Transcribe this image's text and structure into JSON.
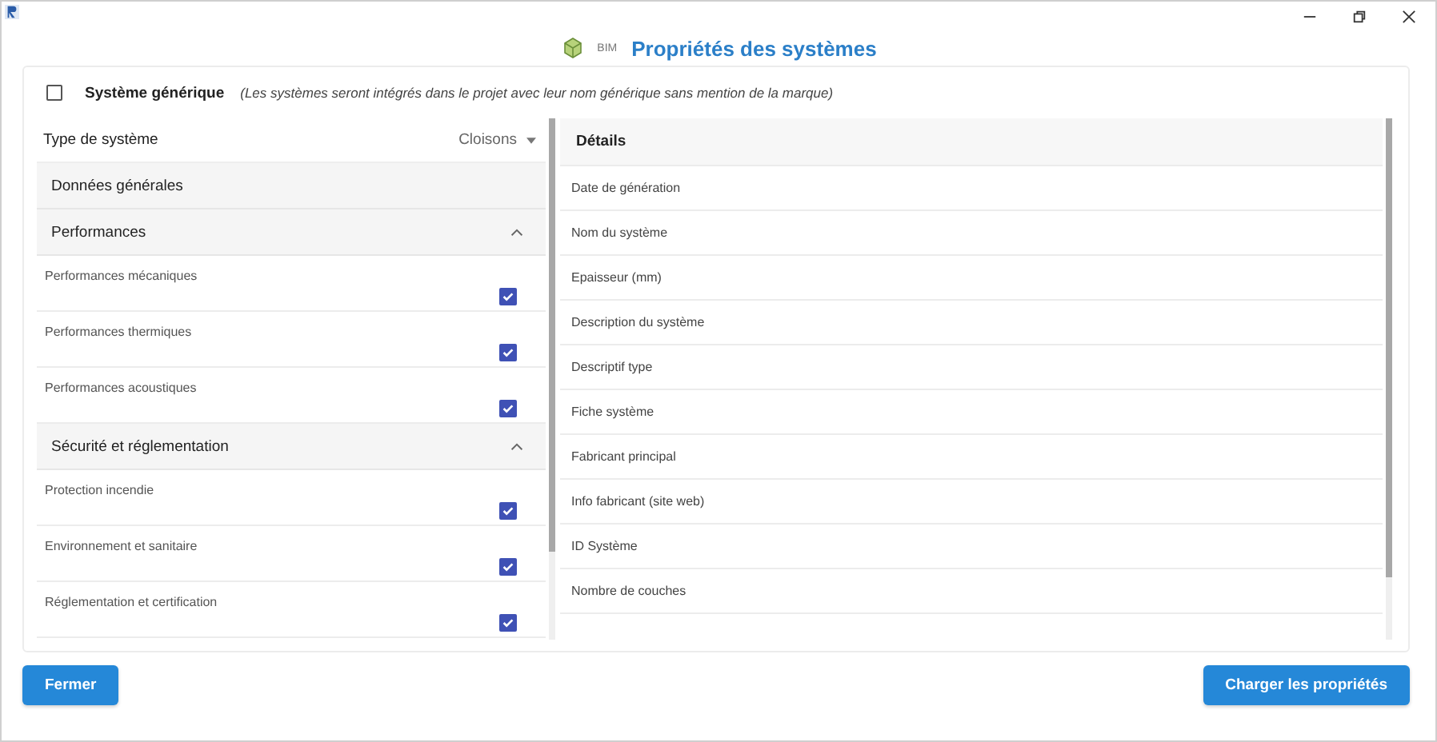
{
  "window": {
    "title": "Propriétés des systèmes",
    "logo_text": "BIM"
  },
  "generic": {
    "label": "Système générique",
    "note": "(Les systèmes seront intégrés dans le projet avec leur nom générique sans mention de la marque)",
    "checked": false
  },
  "type_selector": {
    "label": "Type de système",
    "value": "Cloisons"
  },
  "sections": [
    {
      "kind": "plain",
      "title": "Données générales"
    },
    {
      "kind": "group",
      "title": "Performances",
      "expanded": true,
      "items": [
        {
          "label": "Performances mécaniques",
          "checked": true
        },
        {
          "label": "Performances thermiques",
          "checked": true
        },
        {
          "label": "Performances acoustiques",
          "checked": true
        }
      ]
    },
    {
      "kind": "group",
      "title": "Sécurité et réglementation",
      "expanded": true,
      "items": [
        {
          "label": "Protection incendie",
          "checked": true
        },
        {
          "label": "Environnement et sanitaire",
          "checked": true
        },
        {
          "label": "Réglementation et certification",
          "checked": true
        }
      ]
    }
  ],
  "details": {
    "title": "Détails",
    "rows": [
      "Date de génération",
      "Nom du système",
      "Epaisseur (mm)",
      "Description du système",
      "Descriptif type",
      "Fiche système",
      "Fabricant principal",
      "Info fabricant (site web)",
      "ID Système",
      "Nombre de couches"
    ]
  },
  "buttons": [
    {
      "label": "Fermer"
    },
    {
      "label": "Charger les propriétés"
    }
  ]
}
